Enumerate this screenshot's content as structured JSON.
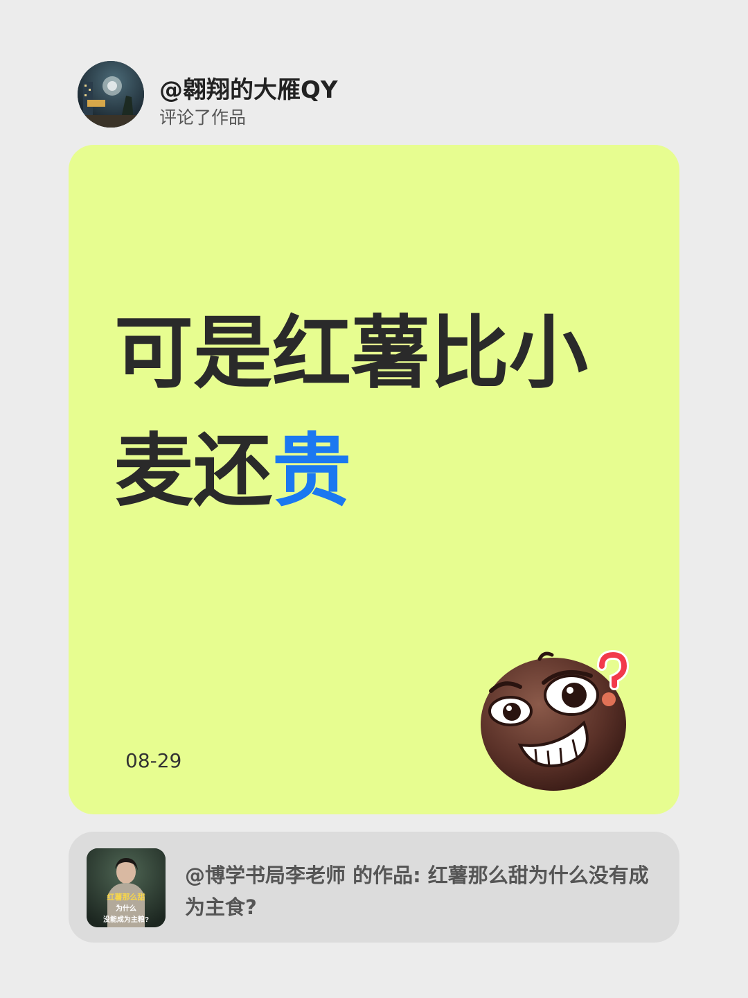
{
  "header": {
    "username": "@翱翔的大雁QY",
    "action": "评论了作品"
  },
  "comment": {
    "text_main": "可是红薯比小麦还",
    "text_highlight": "贵",
    "highlight_color": "#1b78f0",
    "date": "08-29"
  },
  "card": {
    "background": "#e7fd90"
  },
  "reference": {
    "text": "@博学书局李老师 的作品: 红薯那么甜为什么没有成为主食?",
    "thumb_caption_line1": "红薯那么甜",
    "thumb_caption_line2": "为什么",
    "thumb_caption_line3": "没能成为主粮?"
  },
  "icons": {
    "avatar": "avatar-icon",
    "emoji": "smirking-question-emoji-icon"
  }
}
